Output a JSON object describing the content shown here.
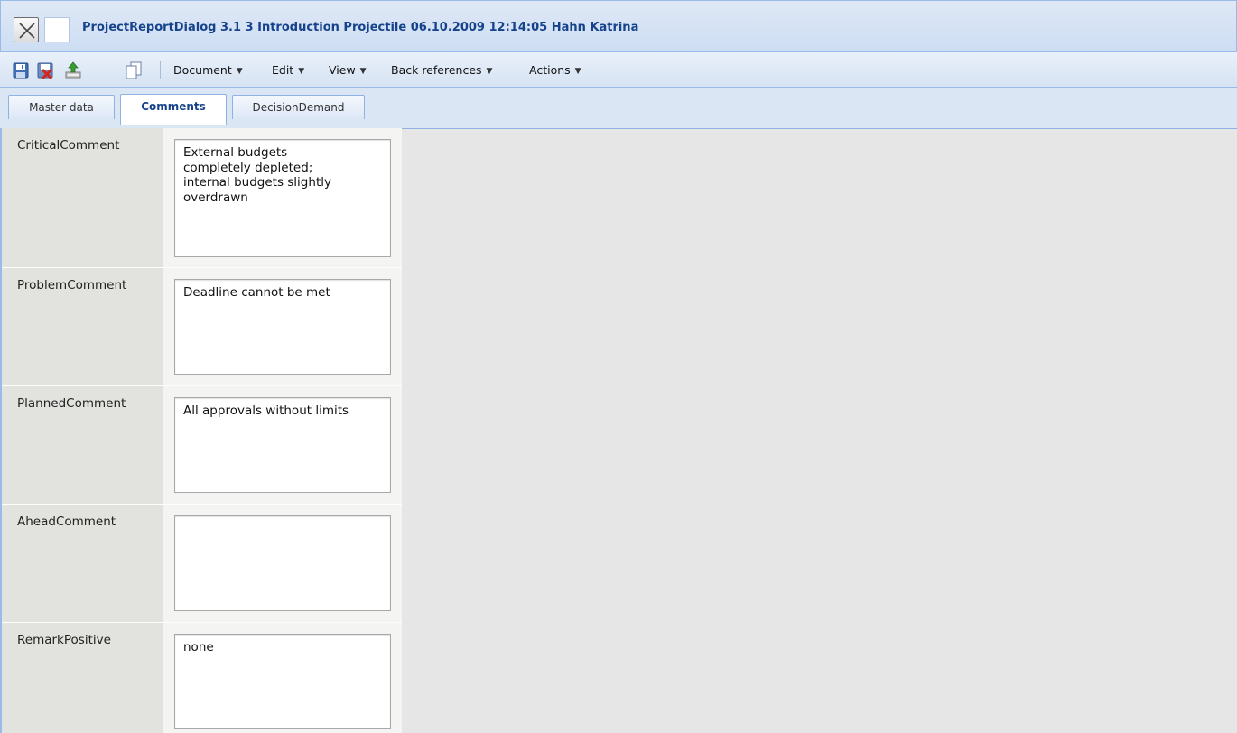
{
  "window": {
    "title": "ProjectReportDialog 3.1 3 Introduction Projectile 06.10.2009 12:14:05 Hahn Katrina"
  },
  "toolbar": {
    "icons": [
      "save-icon",
      "discard-icon",
      "upload-icon",
      "copy-icon"
    ],
    "menus": [
      {
        "label": "Document"
      },
      {
        "label": "Edit"
      },
      {
        "label": "View"
      },
      {
        "label": "Back references"
      },
      {
        "label": "Actions"
      }
    ],
    "menu_arrow": "▼"
  },
  "tabs": [
    {
      "label": "Master data",
      "active": false
    },
    {
      "label": "Comments",
      "active": true
    },
    {
      "label": "DecisionDemand",
      "active": false
    }
  ],
  "fields": [
    {
      "label": "CriticalComment",
      "value": "External budgets\ncompletely depleted;\ninternal budgets slightly\noverdrawn"
    },
    {
      "label": "ProblemComment",
      "value": "Deadline cannot be met"
    },
    {
      "label": "PlannedComment",
      "value": "All approvals without limits"
    },
    {
      "label": "AheadComment",
      "value": ""
    },
    {
      "label": "RemarkPositive",
      "value": "none"
    }
  ],
  "colors": {
    "title_text": "#15428b",
    "accent_border": "#99bbe8",
    "content_background": "#e6e6e6"
  }
}
